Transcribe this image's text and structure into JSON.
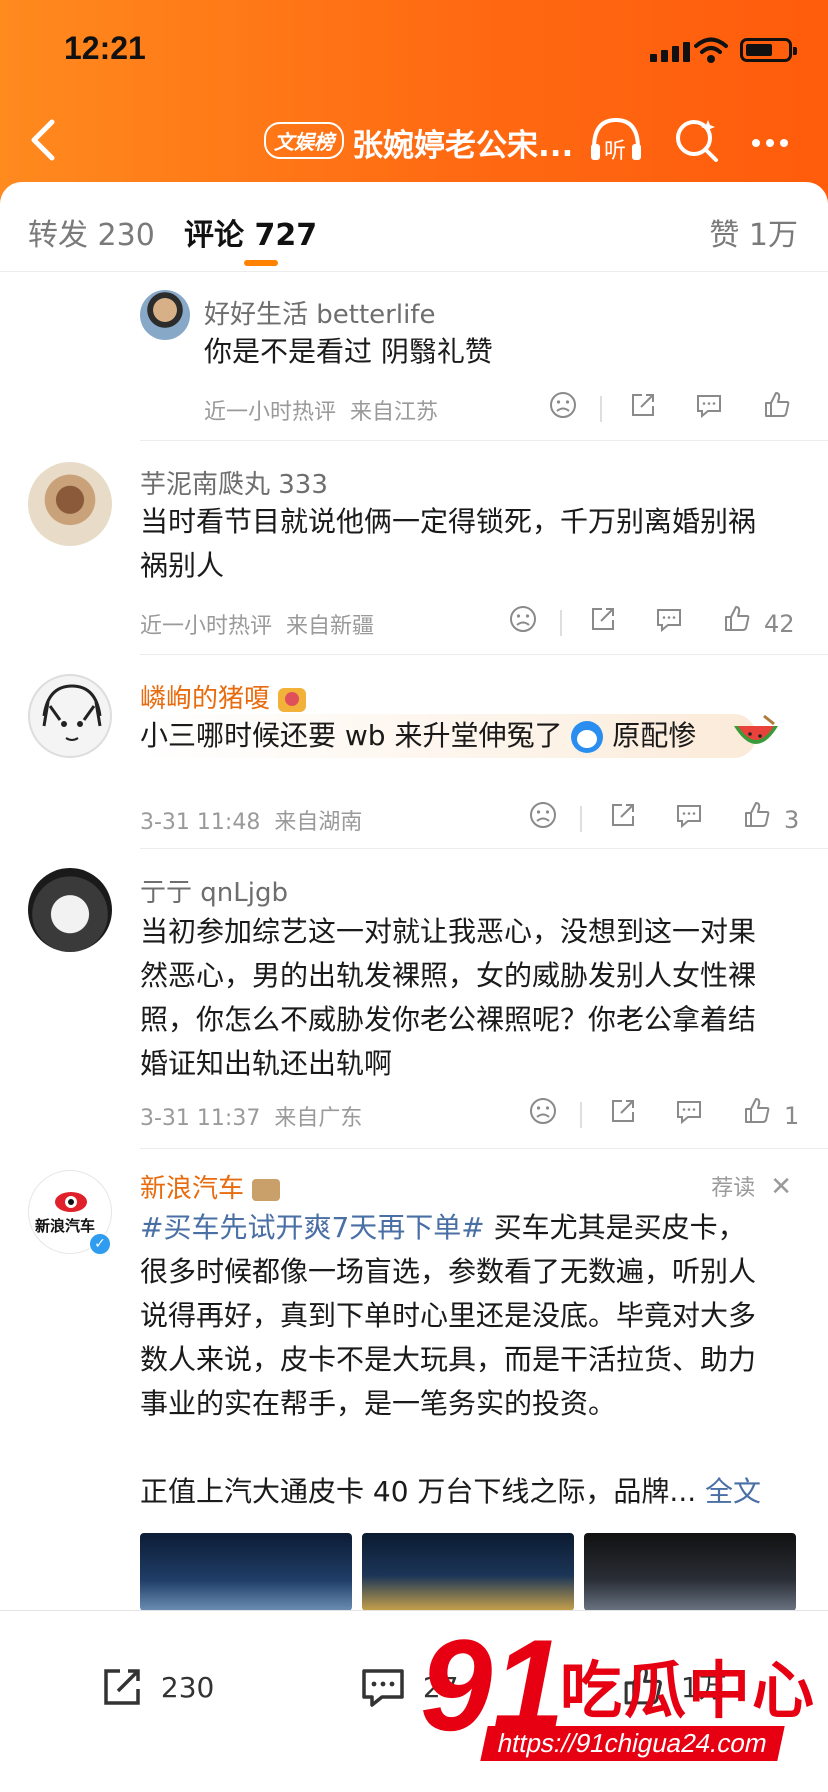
{
  "status": {
    "time": "12:21"
  },
  "nav": {
    "badge": "文娱榜",
    "title": "张婉婷老公宋...",
    "listen_label": "听"
  },
  "tabs": {
    "repost": "转发 230",
    "comment": "评论 727",
    "like": "赞 1万"
  },
  "comments": [
    {
      "user": "好好生活 betterlife",
      "text": "你是不是看过 阴翳礼赞",
      "time": "近一小时热评",
      "location": "来自江苏",
      "likes": ""
    },
    {
      "user": "芋泥南瓞丸 333",
      "text_line1": "当时看节目就说他俩一定得锁死，千万别离婚别祸",
      "text_line2": "祸别人",
      "time": "近一小时热评",
      "location": "来自新疆",
      "likes": "42"
    },
    {
      "user": "嶙峋的猪嗄",
      "text_before": "小三哪时候还要 wb 来升堂伸冤了",
      "text_after": "原配惨",
      "time": "3-31 11:48",
      "location": "来自湖南",
      "likes": "3"
    },
    {
      "user": "亍亍 qnLjgb",
      "text_line1": "当初参加综艺这一对就让我恶心，没想到这一对果",
      "text_line2": "然恶心，男的出轨发裸照，女的威胁发别人女性裸",
      "text_line3": "照，你怎么不威胁发你老公裸照呢？你老公拿着结",
      "text_line4": "婚证知出轨还出轨啊",
      "time": "3-31 11:37",
      "location": "来自广东",
      "likes": "1"
    }
  ],
  "ad": {
    "user": "新浪汽车",
    "avatar_text": "新浪汽车",
    "tag": "荐读",
    "hashtag": "#买车先试开爽7天再下单#",
    "line1_rest": " 买车尤其是买皮卡，",
    "line2": "很多时候都像一场盲选，参数看了无数遍，听别人",
    "line3": "说得再好，真到下单时心里还是没底。毕竟对大多",
    "line4": "数人来说，皮卡不是大玩具，而是干活拉货、助力",
    "line5": "事业的实在帮手，是一笔务实的投资。",
    "line6": "正值上汽大通皮卡 40 万台下线之际，品牌... ",
    "full_text": "全文"
  },
  "bottom": {
    "repost_count": "230",
    "comment_count": "27",
    "like_count": "1万"
  },
  "watermark": {
    "number": "91",
    "name": "吃瓜中心",
    "url": "https://91chigua24.com"
  },
  "colors": {
    "header_orange": "#ff6a12",
    "accent": "#ff8200",
    "link_blue": "#4a6fa5",
    "vip_orange": "#e86b0d"
  }
}
